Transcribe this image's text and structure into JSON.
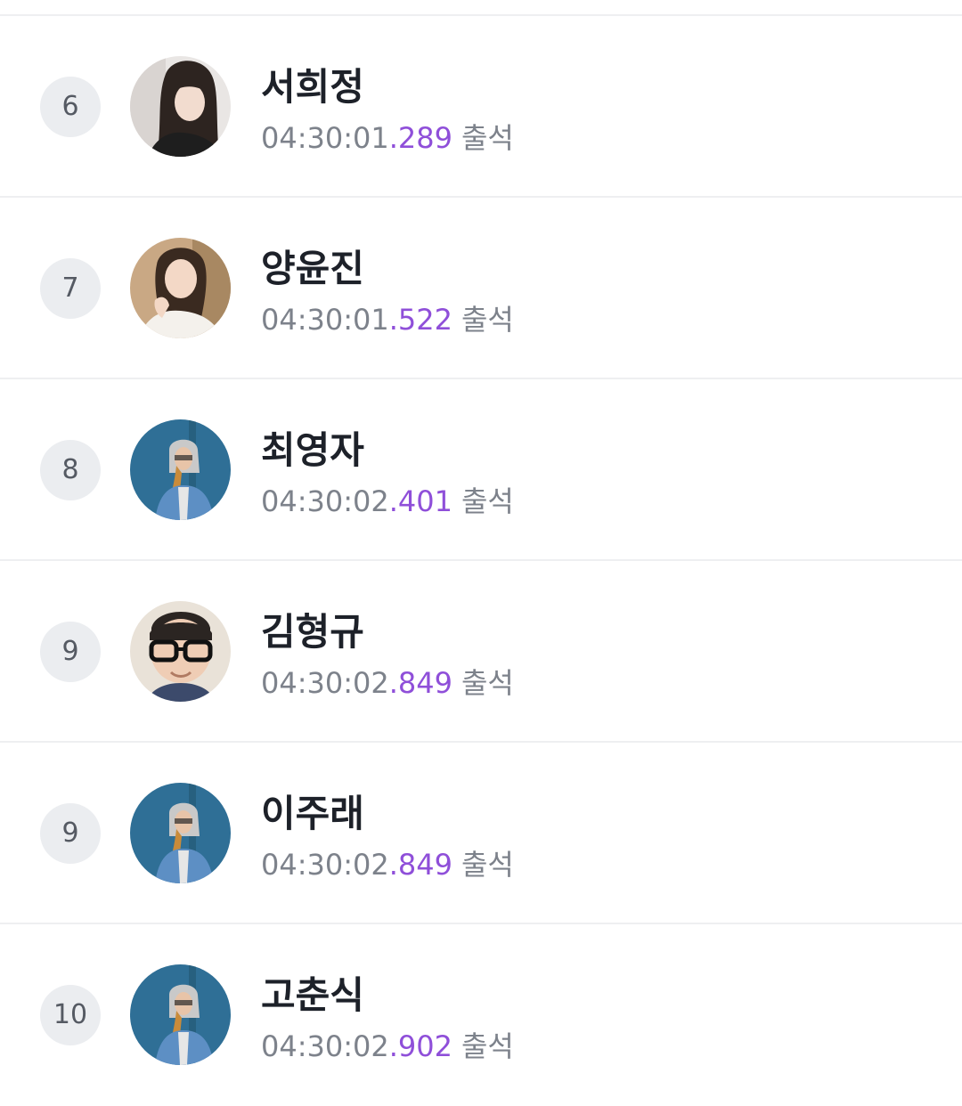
{
  "attendees": [
    {
      "rank": "6",
      "name": "서희정",
      "time": "04:30:01",
      "ms": ".289",
      "status": "출석",
      "avatar": "woman-selfie"
    },
    {
      "rank": "7",
      "name": "양윤진",
      "time": "04:30:01",
      "ms": ".522",
      "status": "출석",
      "avatar": "woman-smiling"
    },
    {
      "rank": "8",
      "name": "최영자",
      "time": "04:30:02",
      "ms": ".401",
      "status": "출석",
      "avatar": "default-hoodie"
    },
    {
      "rank": "9",
      "name": "김형규",
      "time": "04:30:02",
      "ms": ".849",
      "status": "출석",
      "avatar": "man-glasses"
    },
    {
      "rank": "9",
      "name": "이주래",
      "time": "04:30:02",
      "ms": ".849",
      "status": "출석",
      "avatar": "default-hoodie"
    },
    {
      "rank": "10",
      "name": "고춘식",
      "time": "04:30:02",
      "ms": ".902",
      "status": "출석",
      "avatar": "default-hoodie"
    }
  ],
  "colors": {
    "accent": "#8f4fd9",
    "name": "#1d2129",
    "muted": "#7d828b",
    "rank_bg": "#ebedf0",
    "divider": "#eeeff1"
  }
}
